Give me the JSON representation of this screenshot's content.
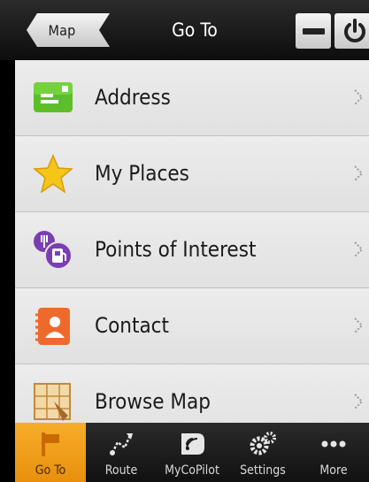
{
  "header": {
    "back_label": "Map",
    "title": "Go To"
  },
  "list": {
    "items": [
      {
        "label": "Address",
        "icon": "address-card-icon"
      },
      {
        "label": "My Places",
        "icon": "star-icon"
      },
      {
        "label": "Points of Interest",
        "icon": "poi-icon"
      },
      {
        "label": "Contact",
        "icon": "contact-icon"
      },
      {
        "label": "Browse Map",
        "icon": "browse-map-icon"
      }
    ]
  },
  "tabs": [
    {
      "label": "Go To",
      "icon": "flag-icon",
      "active": true
    },
    {
      "label": "Route",
      "icon": "route-icon",
      "active": false
    },
    {
      "label": "MyCoPilot",
      "icon": "mycopilot-icon",
      "active": false
    },
    {
      "label": "Settings",
      "icon": "gears-icon",
      "active": false
    },
    {
      "label": "More",
      "icon": "more-dots-icon",
      "active": false
    }
  ],
  "colors": {
    "accent_orange": "#f0a020",
    "address_green": "#5cbf2a",
    "star_yellow": "#f5c518",
    "poi_purple": "#7a3fb0",
    "contact_orange": "#ee6a2c"
  }
}
